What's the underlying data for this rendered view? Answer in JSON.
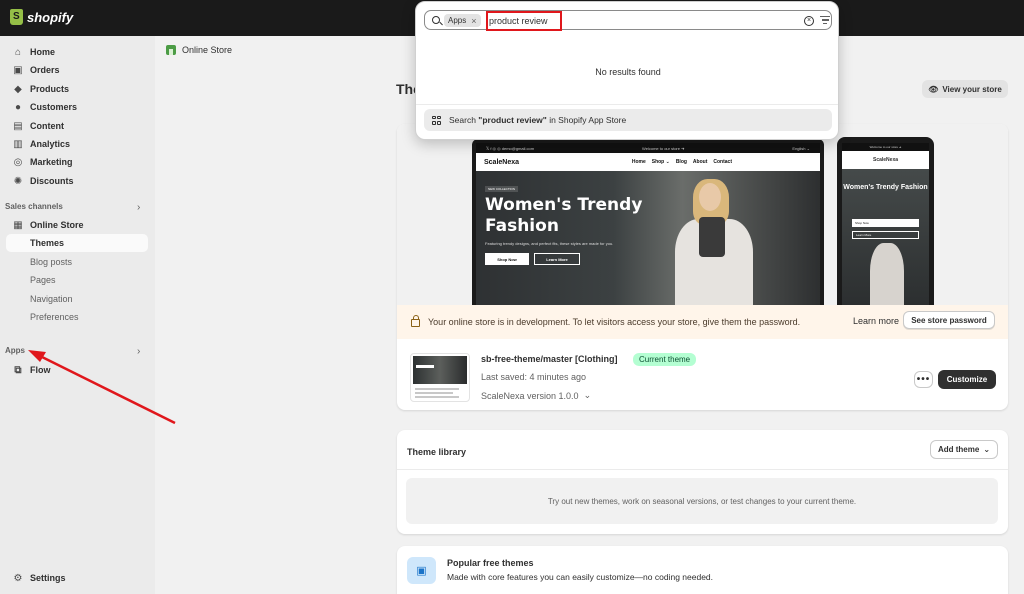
{
  "topbar": {
    "brand": "shopify"
  },
  "sidebar": {
    "items": [
      {
        "label": "Home",
        "icon": "home-icon"
      },
      {
        "label": "Orders",
        "icon": "inbox-icon"
      },
      {
        "label": "Products",
        "icon": "tag-icon"
      },
      {
        "label": "Customers",
        "icon": "person-icon"
      },
      {
        "label": "Content",
        "icon": "image-icon"
      },
      {
        "label": "Analytics",
        "icon": "chart-icon"
      },
      {
        "label": "Marketing",
        "icon": "target-icon"
      },
      {
        "label": "Discounts",
        "icon": "discount-icon"
      }
    ],
    "sales_channels_label": "Sales channels",
    "online_store": "Online Store",
    "sub_items": [
      "Themes",
      "Blog posts",
      "Pages",
      "Navigation",
      "Preferences"
    ],
    "apps_label": "Apps",
    "flow": "Flow",
    "settings": "Settings"
  },
  "main": {
    "breadcrumb": "Online Store",
    "title": "The",
    "view_store": "View your store",
    "preview": {
      "announcement_left": "𝕏  f  ◎  ◎    demo@gmail.com",
      "announcement_mid": "Welcome to our store  ➔",
      "announcement_right": "English ⌄",
      "brand": "ScaleNexa",
      "nav_links": [
        "Home",
        "Shop ⌄",
        "Blog",
        "About",
        "Contact"
      ],
      "tag": "NEW COLLECTION",
      "headline": "Women's Trendy Fashion",
      "subline": "Featuring trendy designs, and perfect fits, these styles are made for you.",
      "shop_now": "Shop Now",
      "learn_more": "Learn More",
      "mobile_announcement": "Welcome to our store  ➔",
      "mobile_headline": "Women's Trendy Fashion",
      "mobile_shop_now": "Shop Now",
      "mobile_learn_more": "Learn More"
    },
    "dev_banner": "Your online store is in development. To let visitors access your store, give them the password.",
    "learn_more": "Learn more",
    "see_password": "See store password",
    "theme": {
      "name": "sb-free-theme/master [Clothing]",
      "badge": "Current theme",
      "last_saved": "Last saved: 4 minutes ago",
      "version": "ScaleNexa version 1.0.0",
      "more": "•••",
      "customize": "Customize"
    },
    "library": {
      "title": "Theme library",
      "add_theme": "Add theme",
      "empty": "Try out new themes, work on seasonal versions, or test changes to your current theme."
    },
    "popular": {
      "title": "Popular free themes",
      "subtitle": "Made with core features you can easily customize—no coding needed."
    }
  },
  "search": {
    "chip": "Apps",
    "query": "product review",
    "no_results": "No results found",
    "app_store_prefix": "Search ",
    "app_store_query": "\"product review\"",
    "app_store_suffix": " in Shopify App Store"
  },
  "colors": {
    "topbar": "#1a1a1a",
    "sidebar": "#ebebeb",
    "accent_green": "#b4fed2",
    "highlight_red": "#e0171c"
  }
}
